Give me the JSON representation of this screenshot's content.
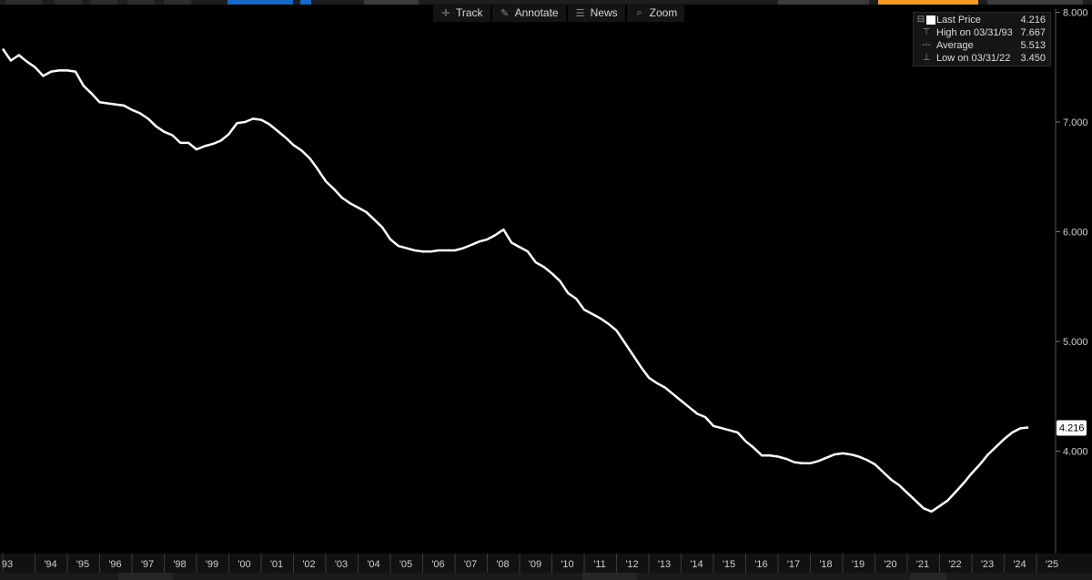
{
  "toolbar": {
    "buttons": [
      {
        "label": "Track",
        "icon": "crosshair-icon"
      },
      {
        "label": "Annotate",
        "icon": "pencil-icon"
      },
      {
        "label": "News",
        "icon": "news-icon"
      },
      {
        "label": "Zoom",
        "icon": "magnifier-icon"
      }
    ]
  },
  "legend": {
    "last_price_label": "Last Price",
    "last_price_value": "4.216",
    "high_label": "High on 03/31/93",
    "high_value": "7.667",
    "average_label": "Average",
    "average_value": "5.513",
    "low_label": "Low on 03/31/22",
    "low_value": "3.450"
  },
  "colors": {
    "background": "#000000",
    "line": "#ffffff",
    "toolbar_blue": "#1668c9",
    "toolbar_orange": "#f39a1e"
  },
  "chart_data": {
    "type": "line",
    "title": "",
    "xlabel": "",
    "ylabel": "",
    "ylim": [
      3.0,
      8.0
    ],
    "y_ticks": [
      "8.000",
      "7.000",
      "6.000",
      "5.000",
      "4.000"
    ],
    "y_tick_values": [
      8,
      7,
      6,
      5,
      4
    ],
    "x_tick_labels": [
      "93",
      "'94",
      "'95",
      "'96",
      "'97",
      "'98",
      "'99",
      "'00",
      "'01",
      "'02",
      "'03",
      "'04",
      "'05",
      "'06",
      "'07",
      "'08",
      "'09",
      "'10",
      "'11",
      "'12",
      "'13",
      "'14",
      "'15",
      "'16",
      "'17",
      "'18",
      "'19",
      "'20",
      "'21",
      "'22",
      "'23",
      "'24",
      "'25"
    ],
    "x_tick_years": [
      1993,
      1994,
      1995,
      1996,
      1997,
      1998,
      1999,
      2000,
      2001,
      2002,
      2003,
      2004,
      2005,
      2006,
      2007,
      2008,
      2009,
      2010,
      2011,
      2012,
      2013,
      2014,
      2015,
      2016,
      2017,
      2018,
      2019,
      2020,
      2021,
      2022,
      2023,
      2024,
      2025
    ],
    "last_value_label": "4.216",
    "grid": false,
    "legend_position": "top-right",
    "series": [
      {
        "name": "Last Price",
        "x": [
          1993.0,
          1993.25,
          1993.5,
          1993.75,
          1994.0,
          1994.25,
          1994.5,
          1994.75,
          1995.0,
          1995.25,
          1995.5,
          1995.75,
          1996.0,
          1996.25,
          1996.5,
          1996.75,
          1997.0,
          1997.25,
          1997.5,
          1997.75,
          1998.0,
          1998.25,
          1998.5,
          1998.75,
          1999.0,
          1999.25,
          1999.5,
          1999.75,
          2000.0,
          2000.25,
          2000.5,
          2000.75,
          2001.0,
          2001.25,
          2001.5,
          2001.75,
          2002.0,
          2002.25,
          2002.5,
          2002.75,
          2003.0,
          2003.25,
          2003.5,
          2003.75,
          2004.0,
          2004.25,
          2004.5,
          2004.75,
          2005.0,
          2005.25,
          2005.5,
          2005.75,
          2006.0,
          2006.25,
          2006.5,
          2006.75,
          2007.0,
          2007.25,
          2007.5,
          2007.75,
          2008.0,
          2008.25,
          2008.5,
          2008.75,
          2009.0,
          2009.25,
          2009.5,
          2009.75,
          2010.0,
          2010.25,
          2010.5,
          2010.75,
          2011.0,
          2011.25,
          2011.5,
          2011.75,
          2012.0,
          2012.25,
          2012.5,
          2012.75,
          2013.0,
          2013.25,
          2013.5,
          2013.75,
          2014.0,
          2014.25,
          2014.5,
          2014.75,
          2015.0,
          2015.25,
          2015.5,
          2015.75,
          2016.0,
          2016.25,
          2016.5,
          2016.75,
          2017.0,
          2017.25,
          2017.5,
          2017.75,
          2018.0,
          2018.25,
          2018.5,
          2018.75,
          2019.0,
          2019.25,
          2019.5,
          2019.75,
          2020.0,
          2020.25,
          2020.5,
          2020.75,
          2021.0,
          2021.25,
          2021.5,
          2021.75,
          2022.0,
          2022.25,
          2022.5,
          2022.75,
          2023.0,
          2023.25,
          2023.5,
          2023.75,
          2024.0,
          2024.25,
          2024.5,
          2024.75
        ],
        "y": [
          7.667,
          7.56,
          7.61,
          7.55,
          7.5,
          7.42,
          7.46,
          7.47,
          7.47,
          7.46,
          7.33,
          7.26,
          7.18,
          7.17,
          7.16,
          7.15,
          7.11,
          7.08,
          7.03,
          6.96,
          6.91,
          6.88,
          6.81,
          6.81,
          6.75,
          6.78,
          6.8,
          6.83,
          6.89,
          6.99,
          7.0,
          7.03,
          7.02,
          6.98,
          6.92,
          6.86,
          6.79,
          6.74,
          6.67,
          6.57,
          6.46,
          6.39,
          6.31,
          6.26,
          6.22,
          6.18,
          6.11,
          6.04,
          5.93,
          5.87,
          5.85,
          5.83,
          5.82,
          5.82,
          5.83,
          5.83,
          5.83,
          5.85,
          5.88,
          5.91,
          5.93,
          5.97,
          6.02,
          5.9,
          5.86,
          5.82,
          5.72,
          5.68,
          5.62,
          5.55,
          5.44,
          5.39,
          5.29,
          5.25,
          5.21,
          5.16,
          5.1,
          4.99,
          4.88,
          4.77,
          4.67,
          4.62,
          4.58,
          4.52,
          4.46,
          4.4,
          4.34,
          4.31,
          4.23,
          4.21,
          4.19,
          4.17,
          4.09,
          4.03,
          3.96,
          3.96,
          3.95,
          3.93,
          3.9,
          3.89,
          3.89,
          3.91,
          3.94,
          3.97,
          3.98,
          3.97,
          3.95,
          3.92,
          3.88,
          3.81,
          3.74,
          3.69,
          3.62,
          3.55,
          3.48,
          3.45,
          3.5,
          3.55,
          3.63,
          3.71,
          3.8,
          3.88,
          3.97,
          4.04,
          4.11,
          4.17,
          4.208,
          4.216
        ]
      }
    ]
  }
}
